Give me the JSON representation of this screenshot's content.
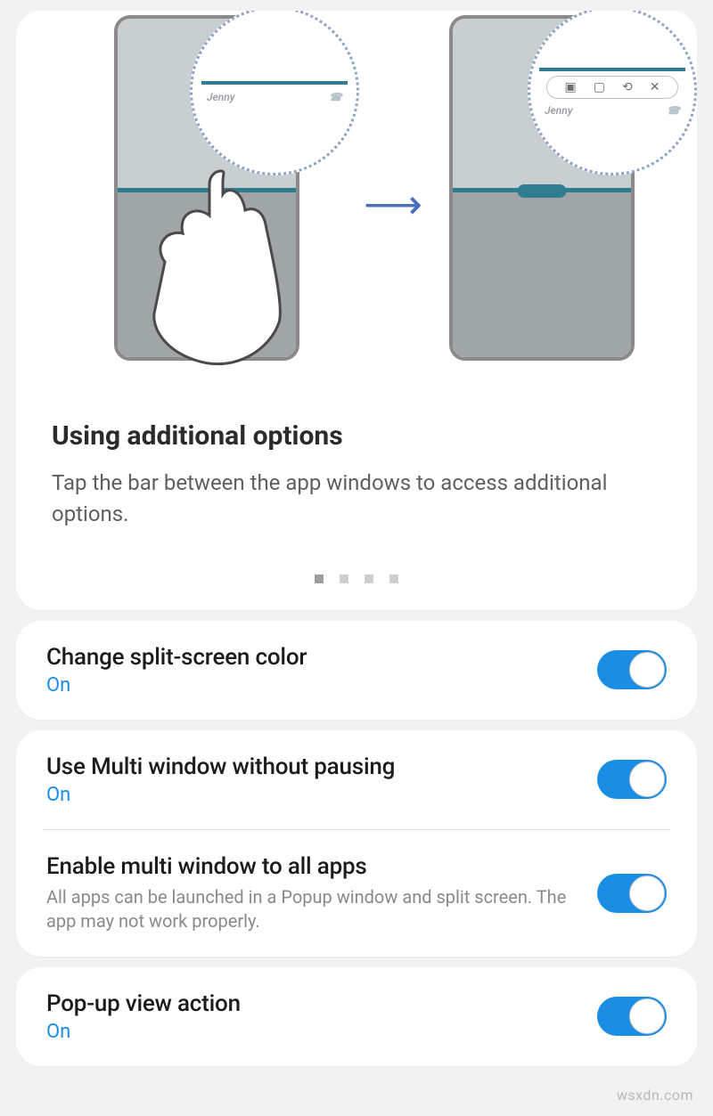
{
  "tutorial": {
    "title": "Using additional options",
    "description": "Tap the bar between the app windows to access additional options.",
    "magnifier_left_label": "Jenny",
    "magnifier_right_label": "Jenny",
    "page_count": 4,
    "active_page_index": 0
  },
  "settings": [
    {
      "title": "Change split-screen color",
      "status": "On",
      "description": "",
      "enabled": true
    },
    {
      "title": "Use Multi window without pausing",
      "status": "On",
      "description": "",
      "enabled": true
    },
    {
      "title": "Enable multi window to all apps",
      "status": "",
      "description": "All apps can be launched in a Popup window and split screen. The app may not work properly.",
      "enabled": true
    },
    {
      "title": "Pop-up view action",
      "status": "On",
      "description": "",
      "enabled": true
    }
  ],
  "watermark": "wsxdn.com"
}
